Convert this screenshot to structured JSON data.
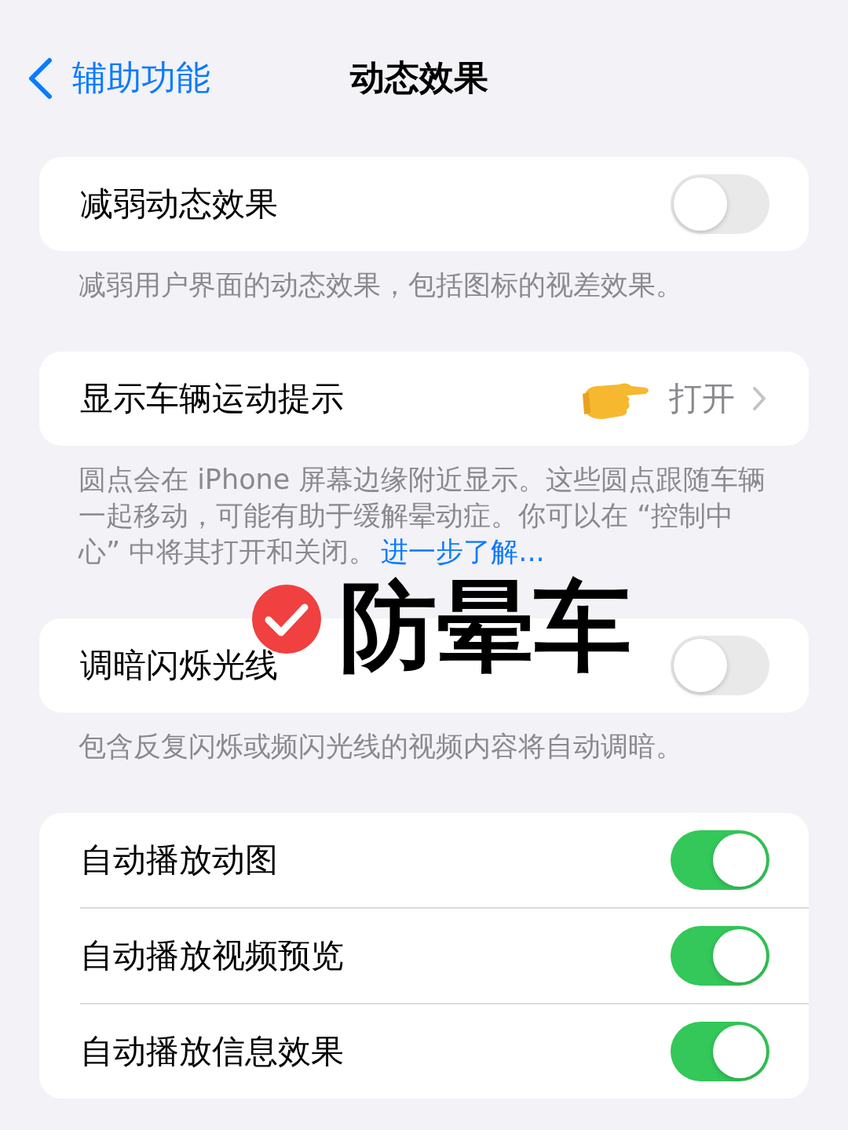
{
  "nav": {
    "back_label": "辅助功能",
    "title": "动态效果"
  },
  "groups": [
    {
      "rows": [
        {
          "kind": "toggle",
          "label": "减弱动态效果",
          "on": false
        }
      ],
      "footer": "减弱用户界面的动态效果，包括图标的视差效果。"
    },
    {
      "rows": [
        {
          "kind": "link",
          "label": "显示车辆运动提示",
          "value": "打开"
        }
      ],
      "footer": "圆点会在 iPhone 屏幕边缘附近显示。这些圆点跟随车辆一起移动，可能有助于缓解晕动症。你可以在 “控制中心” 中将其打开和关闭。",
      "footer_link": "进一步了解..."
    },
    {
      "rows": [
        {
          "kind": "toggle",
          "label": "调暗闪烁光线",
          "on": false
        }
      ],
      "footer": "包含反复闪烁或频闪光线的视频内容将自动调暗。"
    },
    {
      "rows": [
        {
          "kind": "toggle",
          "label": "自动播放动图",
          "on": true
        },
        {
          "kind": "toggle",
          "label": "自动播放视频预览",
          "on": true
        },
        {
          "kind": "toggle",
          "label": "自动播放信息效果",
          "on": true
        }
      ]
    }
  ],
  "overlay": {
    "text": "防晕车"
  }
}
